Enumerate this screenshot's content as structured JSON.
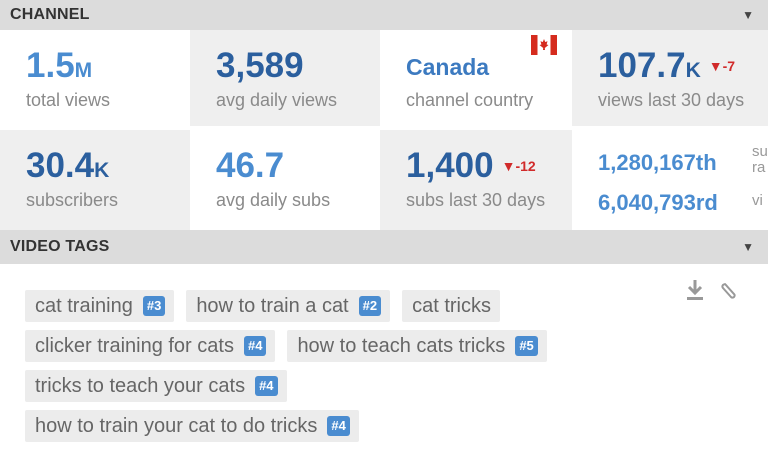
{
  "channel": {
    "header": "CHANNEL",
    "stats": {
      "total_views": {
        "value": "1.5",
        "unit": "M",
        "label": "total views"
      },
      "avg_daily_views": {
        "value": "3,589",
        "label": "avg daily views"
      },
      "country": {
        "value": "Canada",
        "label": "channel country"
      },
      "views_30": {
        "value": "107.7",
        "unit": "K",
        "delta": "▼-7",
        "label": "views last 30 days"
      },
      "subscribers": {
        "value": "30.4",
        "unit": "K",
        "label": "subscribers"
      },
      "avg_daily_subs": {
        "value": "46.7",
        "label": "avg daily subs"
      },
      "subs_30": {
        "value": "1,400",
        "delta": "▼-12",
        "label": "subs last 30 days"
      },
      "rank1": {
        "value": "1,280,167th",
        "side": "su ra"
      },
      "rank2": {
        "value": "6,040,793rd",
        "side": "vi"
      }
    }
  },
  "video_tags": {
    "header": "VIDEO TAGS",
    "tags": [
      [
        {
          "text": "cat training",
          "rank": "#3"
        },
        {
          "text": "how to train a cat",
          "rank": "#2"
        },
        {
          "text": "cat tricks",
          "rank": ""
        }
      ],
      [
        {
          "text": "clicker training for cats",
          "rank": "#4"
        },
        {
          "text": "how to teach cats tricks",
          "rank": "#5"
        }
      ],
      [
        {
          "text": "tricks to teach your cats",
          "rank": "#4"
        }
      ],
      [
        {
          "text": "how to train your cat to do tricks",
          "rank": "#4"
        }
      ]
    ]
  },
  "icons": {
    "collapse": "caret-down-icon",
    "flag": "canada-flag-icon",
    "download": "download-icon",
    "attach": "paperclip-icon"
  },
  "colors": {
    "accent": "#2b5f9e",
    "accent_light": "#4a8cd0",
    "negative": "#d12a2a",
    "header_bg": "#dcdcdc"
  }
}
